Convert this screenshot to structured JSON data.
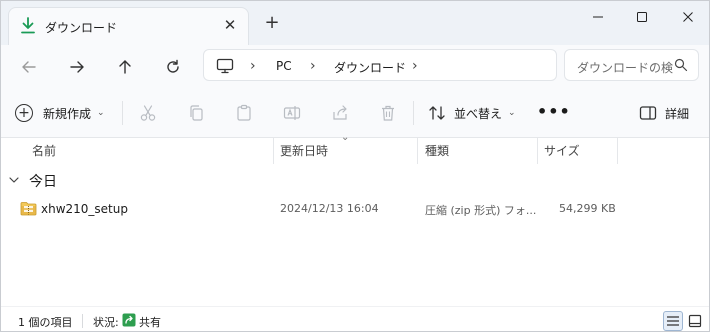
{
  "tab": {
    "title": "ダウンロード",
    "close_glyph": "✕",
    "new_tab_glyph": "+"
  },
  "window_controls": {
    "minimize": "—",
    "maximize": "☐",
    "close": "✕"
  },
  "address": {
    "crumbs": [
      "PC",
      "ダウンロード"
    ],
    "separator": "›"
  },
  "search": {
    "placeholder": "ダウンロードの検索"
  },
  "commandbar": {
    "new_label": "新規作成",
    "sort_label": "並べ替え",
    "more_label": "•••",
    "details_label": "詳細"
  },
  "columns": {
    "name": "名前",
    "modified": "更新日時",
    "type": "種類",
    "size": "サイズ"
  },
  "group": {
    "label": "今日"
  },
  "files": [
    {
      "name": "xhw210_setup",
      "modified": "2024/12/13 16:04",
      "type": "圧縮 (zip 形式) フォ...",
      "size": "54,299 KB"
    }
  ],
  "status": {
    "count": "1 個の項目",
    "state_label": "状況:",
    "share_label": "共有"
  },
  "colors": {
    "accent_download": "#1a9b56",
    "folder_zip": "#e8b84a",
    "window_bg": "#eef2f7",
    "panel_bg": "#f9fafc"
  }
}
